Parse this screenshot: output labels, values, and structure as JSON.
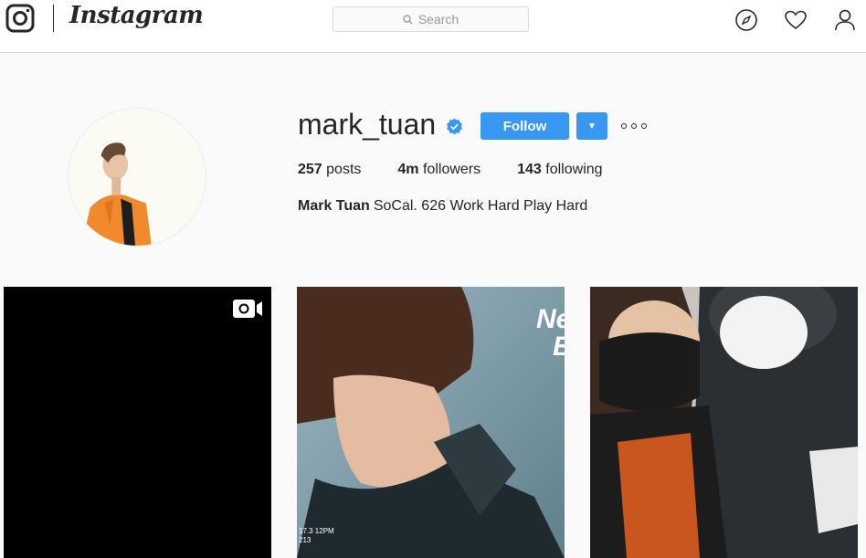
{
  "header": {
    "brand": "Instagram",
    "search_placeholder": "Search",
    "icons": [
      "instagram-camera-icon",
      "search-icon",
      "compass-icon",
      "heart-icon",
      "profile-icon"
    ]
  },
  "profile": {
    "username": "mark_tuan",
    "verified": true,
    "follow_label": "Follow",
    "dropdown_label": "▼",
    "stats": [
      {
        "count": "257",
        "label": "posts"
      },
      {
        "count": "4m",
        "label": "followers"
      },
      {
        "count": "143",
        "label": "following"
      }
    ],
    "full_name": "Mark Tuan",
    "bio": "SoCal. 626 Work Hard Play Hard"
  },
  "posts": [
    {
      "type": "video",
      "icon": "video-icon"
    },
    {
      "type": "image",
      "overlay_text_top": "Ne\nE",
      "overlay_date": "17.3 12PM\n213"
    },
    {
      "type": "image"
    }
  ],
  "colors": {
    "accent": "#3897f0",
    "verified": "#3897f0",
    "background": "#fafafa",
    "text": "#262626",
    "border": "#dbdbdb"
  }
}
